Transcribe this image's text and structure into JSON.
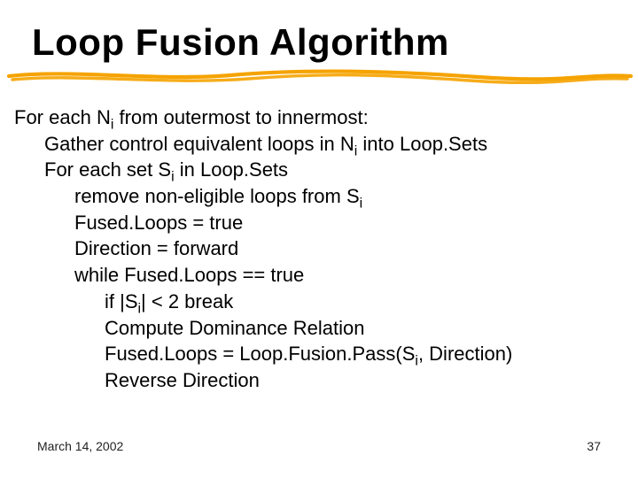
{
  "title": "Loop Fusion Algorithm",
  "lines": [
    {
      "indent": 0,
      "segments": [
        {
          "t": "For each "
        },
        {
          "t": "N",
          "cls": "seg-var"
        },
        {
          "t": "i",
          "sub": true
        },
        {
          "t": " from outermost to innermost:"
        }
      ]
    },
    {
      "indent": 1,
      "segments": [
        {
          "t": "Gather control equivalent loops in "
        },
        {
          "t": "N",
          "cls": "seg-var"
        },
        {
          "t": "i",
          "sub": true
        },
        {
          "t": " into "
        },
        {
          "t": "Loop.Sets",
          "cls": "seg-func"
        }
      ]
    },
    {
      "indent": 1,
      "segments": [
        {
          "t": "For each set "
        },
        {
          "t": "S",
          "cls": "seg-var"
        },
        {
          "t": "i",
          "sub": true
        },
        {
          "t": " in "
        },
        {
          "t": "Loop.Sets",
          "cls": "seg-func"
        }
      ]
    },
    {
      "indent": 2,
      "segments": [
        {
          "t": "remove non-eligible loops from "
        },
        {
          "t": "S",
          "cls": "seg-var"
        },
        {
          "t": "i",
          "sub": true
        }
      ]
    },
    {
      "indent": 2,
      "segments": [
        {
          "t": "Fused.Loops",
          "cls": "seg-func"
        },
        {
          "t": " = true"
        }
      ]
    },
    {
      "indent": 2,
      "segments": [
        {
          "t": "Direction = forward"
        }
      ]
    },
    {
      "indent": 2,
      "segments": [
        {
          "t": "while "
        },
        {
          "t": "Fused.Loops",
          "cls": "seg-func"
        },
        {
          "t": " == true"
        }
      ]
    },
    {
      "indent": 3,
      "segments": [
        {
          "t": "if |"
        },
        {
          "t": "S",
          "cls": "seg-var"
        },
        {
          "t": "i",
          "sub": true
        },
        {
          "t": "| < 2 break"
        }
      ]
    },
    {
      "indent": 3,
      "segments": [
        {
          "t": "Compute Dominance Relation"
        }
      ]
    },
    {
      "indent": 3,
      "segments": [
        {
          "t": "Fused.Loops",
          "cls": "seg-func"
        },
        {
          "t": " = "
        },
        {
          "t": "Loop.Fusion.Pass",
          "cls": "seg-func"
        },
        {
          "t": "("
        },
        {
          "t": "S",
          "cls": "seg-var"
        },
        {
          "t": "i",
          "sub": true
        },
        {
          "t": ", Direction)"
        }
      ]
    },
    {
      "indent": 3,
      "segments": [
        {
          "t": "Reverse Direction"
        }
      ]
    }
  ],
  "footer": {
    "date": "March 14, 2002",
    "page": "37"
  },
  "colors": {
    "accent": "#f5a300"
  }
}
